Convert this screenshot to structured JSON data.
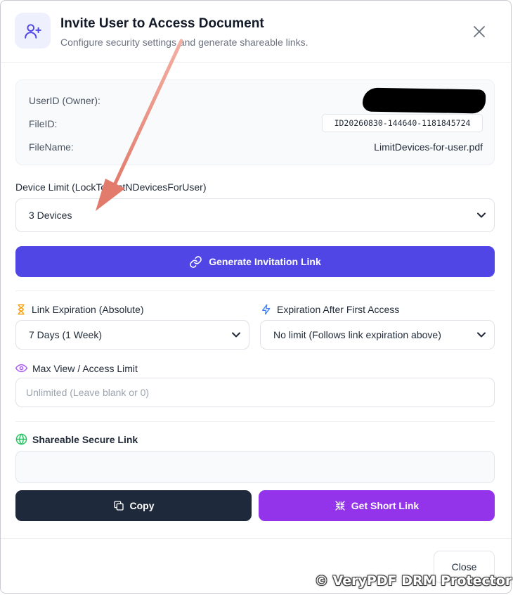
{
  "dialog": {
    "title": "Invite User to Access Document",
    "subtitle": "Configure security settings and generate shareable links."
  },
  "info": {
    "owner_label": "UserID (Owner):",
    "fileid_label": "FileID:",
    "fileid_value": "ID20260830-144640-1181845724",
    "filename_label": "FileName:",
    "filename_value": "LimitDevices-for-user.pdf"
  },
  "device_limit": {
    "label": "Device Limit (LockToFirstNDevicesForUser)",
    "selected": "3 Devices"
  },
  "generate_button": "Generate Invitation Link",
  "link_expiration": {
    "label": "Link Expiration (Absolute)",
    "selected": "7 Days (1 Week)"
  },
  "first_access": {
    "label": "Expiration After First Access",
    "selected": "No limit (Follows link expiration above)"
  },
  "max_view": {
    "label": "Max View / Access Limit",
    "placeholder": "Unlimited (Leave blank or 0)"
  },
  "shareable": {
    "label": "Shareable Secure Link"
  },
  "copy_button": "Copy",
  "short_link_button": "Get Short Link",
  "close_button": "Close",
  "watermark": "© VeryPDF DRM Protector",
  "colors": {
    "primary": "#4f46e5",
    "copy_dark": "#1e293b",
    "short_link_purple": "#9333ea",
    "annotation_arrow": "#e8897a",
    "expiration_icon": "#f59e0b",
    "first_access_icon": "#3b82f6",
    "max_view_icon": "#a855f7",
    "shareable_icon": "#22c55e"
  },
  "icons": {
    "header": "user-plus-icon",
    "close": "close-icon",
    "generate": "link-icon",
    "expiration": "hourglass-icon",
    "first_access": "lightning-icon",
    "max_view": "eye-icon",
    "shareable": "globe-icon",
    "copy": "copy-icon",
    "short_link": "compress-icon"
  }
}
